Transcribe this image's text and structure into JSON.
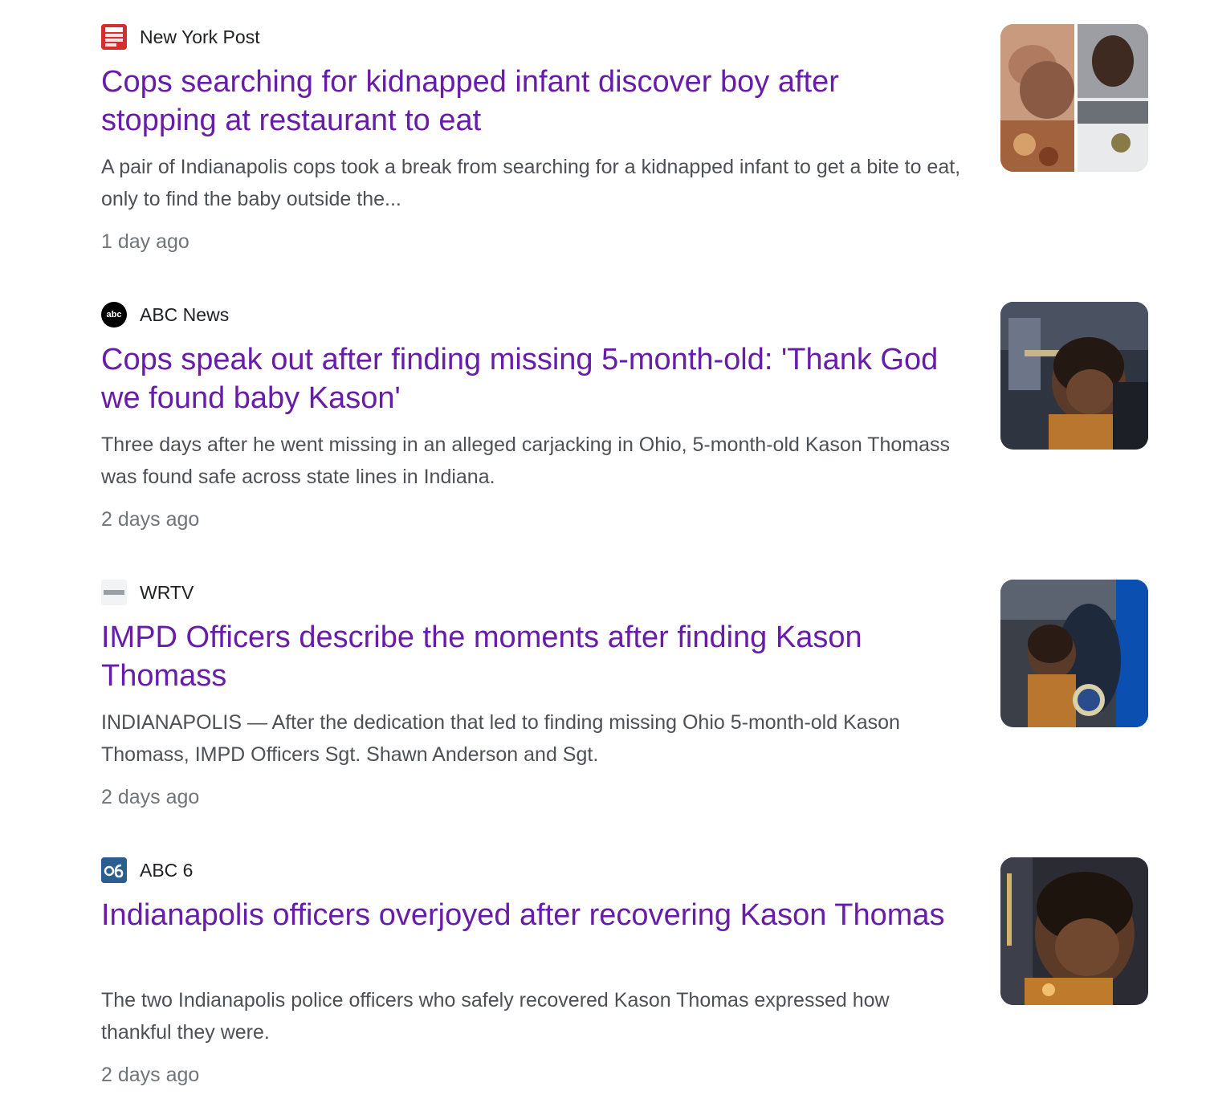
{
  "results": [
    {
      "source": "New York Post",
      "favicon_icon": "new-york-post-logo",
      "title": "Cops searching for kidnapped infant discover boy after stopping at restaurant to eat",
      "snippet": "A pair of Indianapolis cops took a break from searching for a kidnapped infant to get a bite to eat, only to find the baby outside the...",
      "date": "1 day ago"
    },
    {
      "source": "ABC News",
      "favicon_icon": "abc-news-logo",
      "favicon_text": "abc",
      "title": "Cops speak out after finding missing 5-month-old: 'Thank God we found baby Kason'",
      "snippet": "Three days after he went missing in an alleged carjacking in Ohio, 5-month-old Kason Thomass was found safe across state lines in Indiana.",
      "date": "2 days ago"
    },
    {
      "source": "WRTV",
      "favicon_icon": "wrtv-logo",
      "title": "IMPD Officers describe the moments after finding Kason Thomass",
      "snippet": "INDIANAPOLIS — After the dedication that led to finding missing Ohio 5-month-old Kason Thomass, IMPD Officers Sgt. Shawn Anderson and Sgt.",
      "date": "2 days ago"
    },
    {
      "source": "ABC 6",
      "favicon_icon": "abc-6-logo",
      "title": "Indianapolis officers overjoyed after recovering Kason Thomas",
      "snippet": "The two Indianapolis police officers who safely recovered Kason Thomas expressed how thankful they were.",
      "date": "2 days ago"
    }
  ],
  "colors": {
    "title_link": "#681da8",
    "snippet": "#4d5156",
    "date": "#70757a",
    "source": "#202124"
  }
}
